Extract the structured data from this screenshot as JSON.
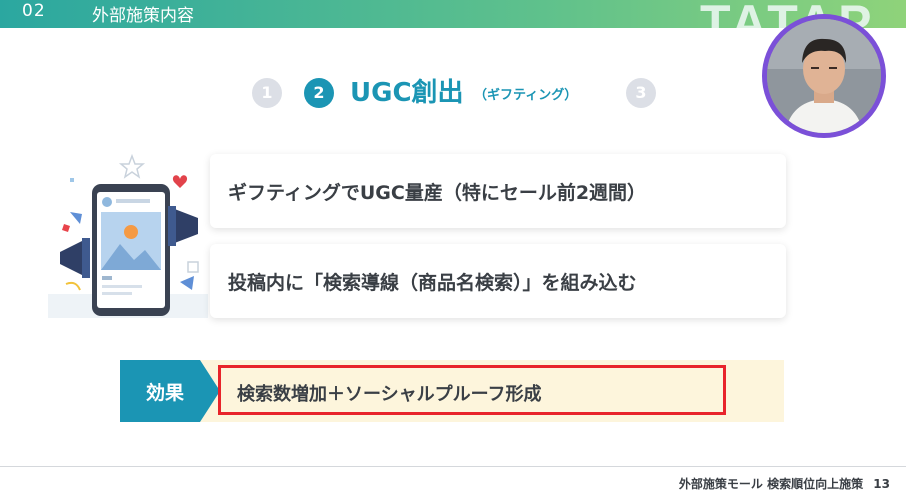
{
  "header": {
    "section_number": "02",
    "section_title": "外部施策内容",
    "brand_text": "TATAP"
  },
  "steps": [
    {
      "label": "1",
      "active": false
    },
    {
      "label": "2",
      "active": true
    },
    {
      "label": "3",
      "active": false
    }
  ],
  "active_step": {
    "title": "UGC創出",
    "subtitle": "（ギフティング）"
  },
  "cards": [
    {
      "text": "ギフティングでUGC量産（特にセール前2週間）"
    },
    {
      "text": "投稿内に「検索導線（商品名検索）」を組み込む"
    }
  ],
  "effect": {
    "label": "効果",
    "text": "検索数増加＋ソーシャルプルーフ形成"
  },
  "footer": {
    "text": "外部施策モール 検索順位向上施策",
    "page_number": "13"
  },
  "colors": {
    "accent": "#1b95b4",
    "highlight_border": "#e8242b",
    "effect_background": "#fdf5dc",
    "avatar_border": "#7b50d8"
  }
}
